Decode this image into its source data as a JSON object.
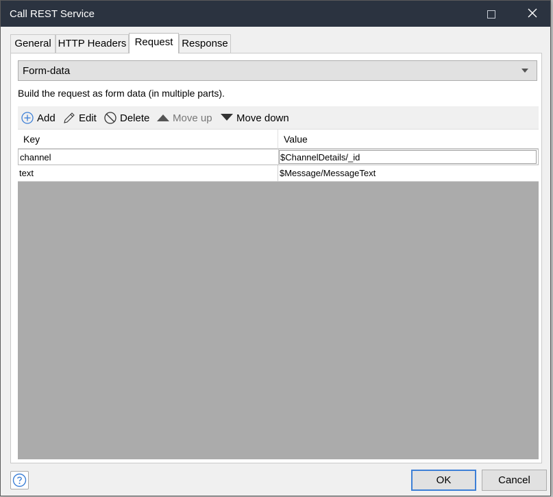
{
  "window": {
    "title": "Call REST Service"
  },
  "tabs": [
    {
      "label": "General"
    },
    {
      "label": "HTTP Headers"
    },
    {
      "label": "Request"
    },
    {
      "label": "Response"
    }
  ],
  "request": {
    "body_type": "Form-data",
    "description": "Build the request as form data (in multiple parts).",
    "toolbar": {
      "add": "Add",
      "edit": "Edit",
      "delete": "Delete",
      "move_up": "Move up",
      "move_down": "Move down"
    },
    "columns": {
      "key": "Key",
      "value": "Value"
    },
    "rows": [
      {
        "key": "channel",
        "value": "$ChannelDetails/_id"
      },
      {
        "key": "text",
        "value": "$Message/MessageText"
      }
    ]
  },
  "footer": {
    "ok": "OK",
    "cancel": "Cancel"
  },
  "colors": {
    "titlebar": "#2b3340",
    "accent": "#3c7fd6",
    "grid_empty": "#ababab"
  }
}
